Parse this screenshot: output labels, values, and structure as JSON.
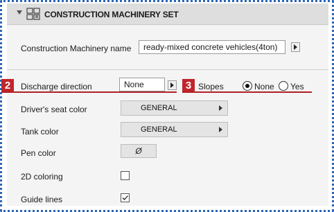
{
  "header": {
    "title": "CONSTRUCTION MACHINERY SET",
    "icon": "construction-set-icon"
  },
  "machinery": {
    "label": "Construction Machinery name",
    "value": "ready-mixed concrete vehicles(4ton)"
  },
  "discharge": {
    "badge": "2",
    "label": "Discharge direction",
    "value": "None"
  },
  "slopes": {
    "badge": "3",
    "label": "Slopes",
    "options": [
      "None",
      "Yes"
    ],
    "selected": "None"
  },
  "driver_seat": {
    "label": "Driver's seat color",
    "value": "GENERAL"
  },
  "tank": {
    "label": "Tank color",
    "value": "GENERAL"
  },
  "pen": {
    "label": "Pen color",
    "value": "Ø"
  },
  "coloring_2d": {
    "label": "2D coloring",
    "checked": false
  },
  "guide_lines": {
    "label": "Guide lines",
    "checked": true
  },
  "colors": {
    "accent_red": "#c0252b",
    "frame_blue": "#2a64b8"
  }
}
